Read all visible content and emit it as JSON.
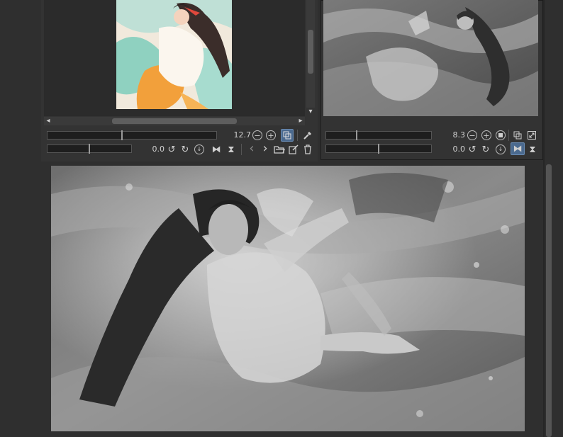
{
  "navigator": {
    "zoom_value": "12.7",
    "rotate_value": "0.0",
    "zoom_level": 0.44,
    "rotate_level": 0.5
  },
  "subview": {
    "zoom_value": "8.3",
    "rotate_value": "0.0",
    "zoom_level": 0.29,
    "rotate_level": 0.5
  },
  "icons": {
    "zoom_out": "−",
    "zoom_in": "+",
    "rotate_left": "↺",
    "rotate_right": "↻",
    "flip_h": "⧓",
    "flip_v": "⧗",
    "prev": "‹",
    "next": "›",
    "scroll_left": "◂",
    "scroll_right": "▸",
    "scroll_down": "▾"
  },
  "colors": {
    "background": "#2f2f2f",
    "accent": "#4b6a8f"
  }
}
